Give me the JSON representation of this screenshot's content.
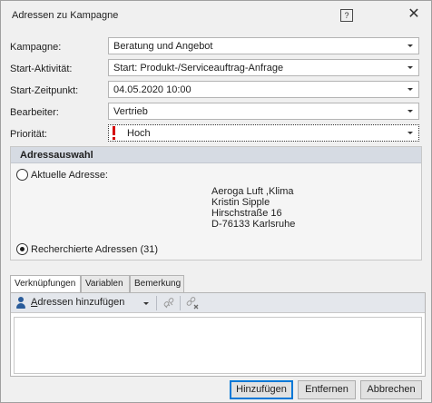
{
  "window": {
    "title": "Adressen zu Kampagne",
    "help_glyph": "?",
    "close_glyph": "✕"
  },
  "form": {
    "kampagne": {
      "label": "Kampagne:",
      "value": "Beratung und Angebot"
    },
    "start_aktivitaet": {
      "label": "Start-Aktivität:",
      "value": "Start: Produkt-/Serviceauftrag-Anfrage"
    },
    "start_zeitpunkt": {
      "label": "Start-Zeitpunkt:",
      "value": "04.05.2020 10:00"
    },
    "bearbeiter": {
      "label": "Bearbeiter:",
      "value": "Vertrieb"
    },
    "prioritaet": {
      "label": "Priorität:",
      "value": "Hoch"
    }
  },
  "address_group": {
    "title": "Adressauswahl",
    "current_address": {
      "label": "Aktuelle Adresse:",
      "selected": false,
      "lines": [
        "Aeroga Luft ,Klima",
        "Kristin Sipple",
        "Hirschstraße 16",
        "D-76133 Karlsruhe"
      ]
    },
    "researched": {
      "label": "Recherchierte Adressen (31)",
      "selected": true
    }
  },
  "tabs": [
    {
      "label": "Verknüpfungen",
      "active": true
    },
    {
      "label": "Variablen",
      "active": false
    },
    {
      "label": "Bemerkung",
      "active": false
    }
  ],
  "toolbar": {
    "add_label_accel": "A",
    "add_label_rest": "dressen hinzufügen"
  },
  "buttons": {
    "add": "Hinzufügen",
    "remove": "Entfernen",
    "cancel": "Abbrechen"
  },
  "colors": {
    "priority_red": "#d40000",
    "group_header": "#d6dbe3",
    "accent_blue": "#0078d7"
  }
}
